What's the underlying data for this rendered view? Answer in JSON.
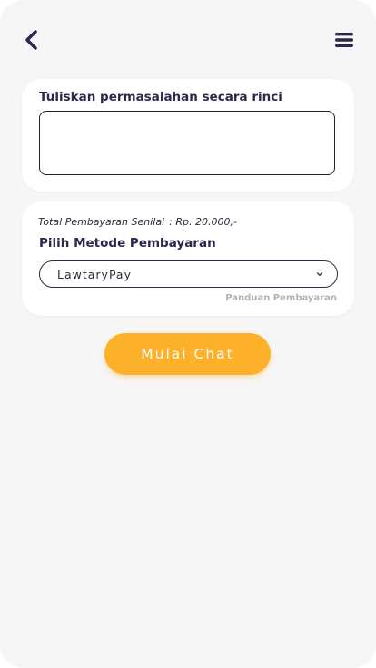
{
  "header": {
    "back_icon": "chevron-left-icon",
    "menu_icon": "hamburger-menu-icon"
  },
  "problem": {
    "label": "Tuliskan permasalahan secara rinci",
    "value": "",
    "placeholder": ""
  },
  "payment": {
    "total_label": "Total Pembayaran Senilai",
    "total_value": ": Rp. 20.000,-",
    "method_label": "Pilih Metode Pembayaran",
    "selected_method": "LawtaryPay",
    "guide_link": "Panduan Pembayaran"
  },
  "actions": {
    "start_chat_label": "Mulai Chat"
  },
  "colors": {
    "accent": "#fdb02a",
    "text_dark": "#2b2a4c",
    "background": "#f6f6f6",
    "card": "#ffffff",
    "muted": "#b3b3b3"
  }
}
